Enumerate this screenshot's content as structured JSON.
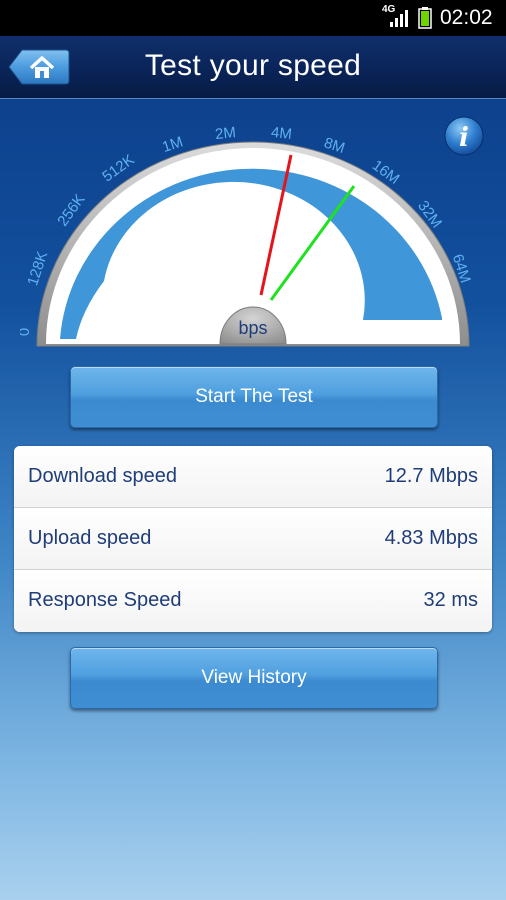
{
  "status_bar": {
    "network": "4G",
    "time": "02:02"
  },
  "header": {
    "title": "Test your speed",
    "home_icon": "home-icon"
  },
  "info": {
    "icon": "info-icon",
    "label": "i"
  },
  "gauge": {
    "center_label": "bps",
    "scale_labels": [
      "0",
      "128K",
      "256K",
      "512K",
      "1M",
      "2M",
      "4M",
      "8M",
      "16M",
      "32M",
      "64M"
    ],
    "colors": {
      "fill": "#3f96d8",
      "rim": "#a9a9a9",
      "download_needle": "#e3141b",
      "upload_needle": "#1ee21e"
    }
  },
  "actions": {
    "start_label": "Start The Test",
    "history_label": "View History"
  },
  "results": [
    {
      "label": "Download speed",
      "value": "12.7 Mbps"
    },
    {
      "label": "Upload speed",
      "value": "4.83 Mbps"
    },
    {
      "label": "Response Speed",
      "value": "32 ms"
    }
  ]
}
